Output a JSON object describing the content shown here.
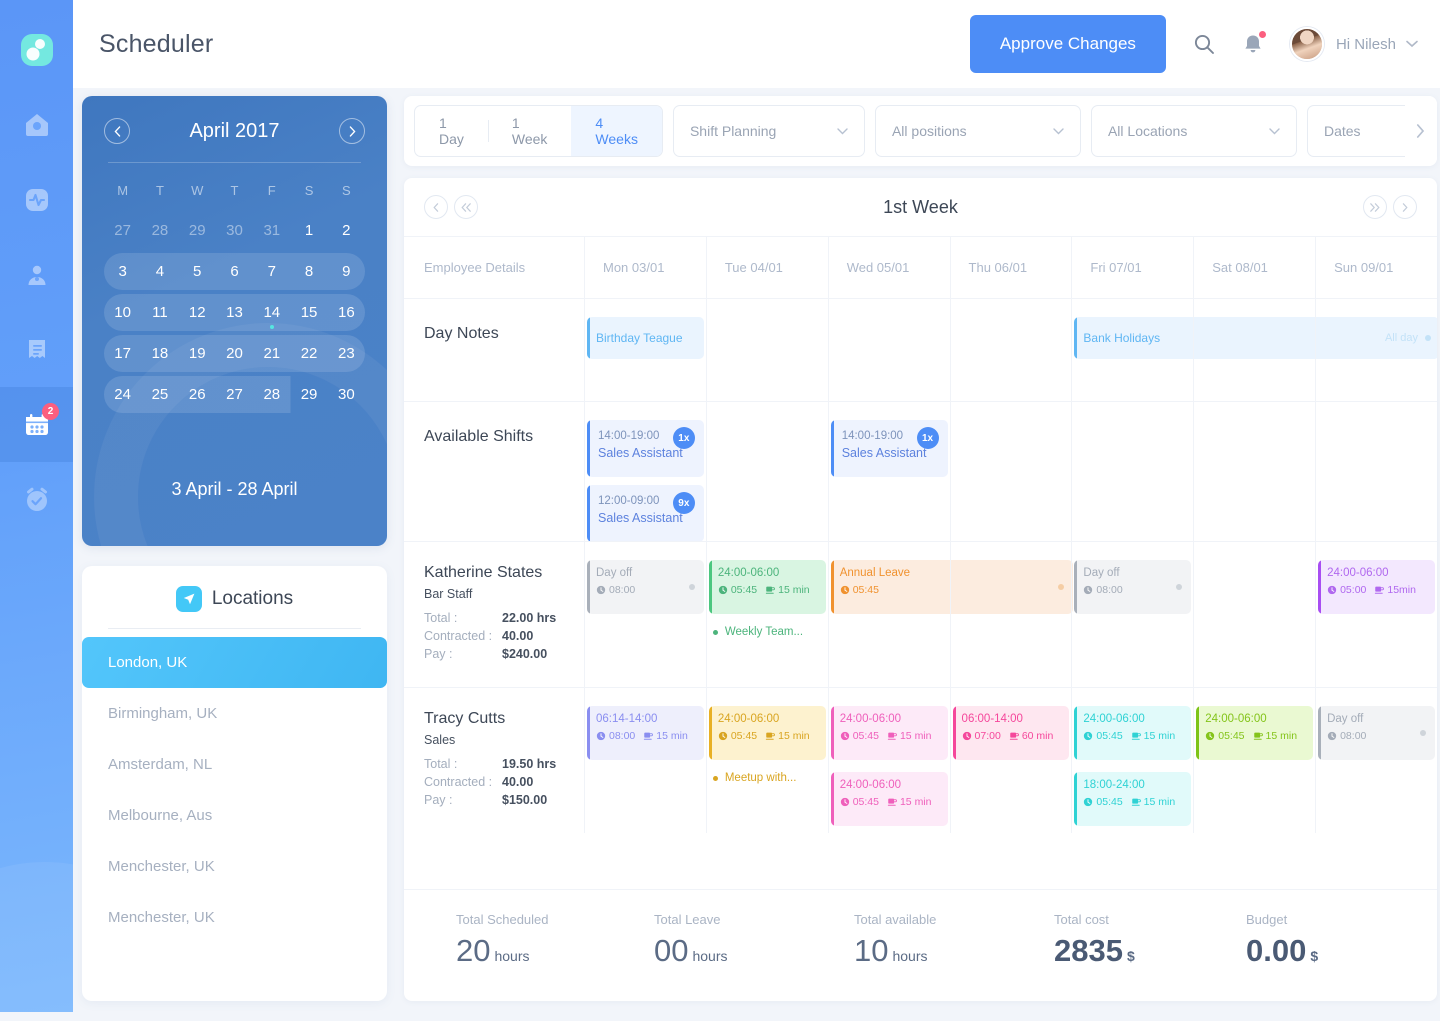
{
  "rail": {
    "items": [
      {
        "name": "logo",
        "icon": "logo-icon",
        "active": false
      },
      {
        "name": "home",
        "icon": "home-icon",
        "active": false
      },
      {
        "name": "activity",
        "icon": "activity-icon",
        "active": false
      },
      {
        "name": "people",
        "icon": "user-icon",
        "active": false
      },
      {
        "name": "documents",
        "icon": "document-icon",
        "active": false
      },
      {
        "name": "scheduler",
        "icon": "calendar-icon",
        "active": true,
        "badge": "2"
      },
      {
        "name": "timeclock",
        "icon": "clock-icon",
        "active": false
      }
    ]
  },
  "header": {
    "title": "Scheduler",
    "approve_label": "Approve Changes",
    "search_icon": "search-icon",
    "bell_icon": "bell-icon",
    "user_greeting": "Hi Nilesh"
  },
  "calendar": {
    "month_label": "April 2017",
    "prev_icon": "chevron-left-icon",
    "next_icon": "chevron-right-icon",
    "dow": [
      "M",
      "T",
      "W",
      "T",
      "F",
      "S",
      "S"
    ],
    "weeks": [
      {
        "selected": "none",
        "days": [
          {
            "n": "27",
            "muted": true
          },
          {
            "n": "28",
            "muted": true
          },
          {
            "n": "29",
            "muted": true
          },
          {
            "n": "30",
            "muted": true
          },
          {
            "n": "31",
            "muted": true
          },
          {
            "n": "1",
            "muted": false
          },
          {
            "n": "2",
            "muted": false
          }
        ]
      },
      {
        "selected": "full",
        "days": [
          {
            "n": "3"
          },
          {
            "n": "4"
          },
          {
            "n": "5"
          },
          {
            "n": "6"
          },
          {
            "n": "7"
          },
          {
            "n": "8"
          },
          {
            "n": "9"
          }
        ]
      },
      {
        "selected": "full",
        "days": [
          {
            "n": "10"
          },
          {
            "n": "11"
          },
          {
            "n": "12"
          },
          {
            "n": "13"
          },
          {
            "n": "14",
            "dot": true
          },
          {
            "n": "15"
          },
          {
            "n": "16"
          }
        ]
      },
      {
        "selected": "full",
        "days": [
          {
            "n": "17"
          },
          {
            "n": "18"
          },
          {
            "n": "19"
          },
          {
            "n": "20"
          },
          {
            "n": "21"
          },
          {
            "n": "22"
          },
          {
            "n": "23"
          }
        ]
      },
      {
        "selected": "partial",
        "days": [
          {
            "n": "24"
          },
          {
            "n": "25"
          },
          {
            "n": "26"
          },
          {
            "n": "27"
          },
          {
            "n": "28"
          },
          {
            "n": "29"
          },
          {
            "n": "30"
          }
        ]
      }
    ],
    "range_label": "3 April - 28 April"
  },
  "locations": {
    "title": "Locations",
    "icon": "location-pin-icon",
    "items": [
      {
        "label": "London, UK",
        "active": true
      },
      {
        "label": "Birmingham, UK",
        "active": false
      },
      {
        "label": "Amsterdam, NL",
        "active": false
      },
      {
        "label": "Melbourne, Aus",
        "active": false
      },
      {
        "label": "Menchester, UK",
        "active": false
      },
      {
        "label": "Menchester, UK",
        "active": false
      }
    ]
  },
  "filters": {
    "segments": [
      {
        "label": "1 Day",
        "active": false
      },
      {
        "label": "1 Week",
        "active": false
      },
      {
        "label": "4 Weeks",
        "active": true
      }
    ],
    "selects": [
      {
        "label": "Shift Planning"
      },
      {
        "label": "All positions"
      },
      {
        "label": "All Locations"
      },
      {
        "label": "Dates"
      }
    ],
    "next_icon": "chevron-right-icon"
  },
  "schedule": {
    "week_title": "1st Week",
    "nav": {
      "prev_icon": "chevron-left-icon",
      "prev_fast_icon": "chevrons-left-icon",
      "next_fast_icon": "chevrons-right-icon",
      "next_icon": "chevron-right-icon"
    },
    "columns": [
      "Employee Details",
      "Mon 03/01",
      "Tue 04/01",
      "Wed 05/01",
      "Thu 06/01",
      "Fri 07/01",
      "Sat 08/01",
      "Sun 09/01"
    ],
    "day_notes": {
      "label": "Day Notes",
      "entries": [
        {
          "day": 0,
          "text": "Birthday Teague",
          "span": 1,
          "allday": ""
        },
        {
          "day": 4,
          "text": "Bank Holidays",
          "span": 3,
          "allday": "All day"
        }
      ]
    },
    "available_shifts": {
      "label": "Available Shifts",
      "entries": [
        {
          "day": 0,
          "time": "14:00-19:00",
          "role": "Sales Assistant",
          "count": "1x"
        },
        {
          "day": 0,
          "time": "12:00-09:00",
          "role": "Sales Assistant",
          "count": "9x"
        },
        {
          "day": 2,
          "time": "14:00-19:00",
          "role": "Sales Assistant",
          "count": "1x"
        }
      ]
    },
    "employees": [
      {
        "name": "Katherine States",
        "role": "Bar Staff",
        "stats": [
          {
            "key": "Total :",
            "value": "22.00 hrs"
          },
          {
            "key": "Contracted :",
            "value": "40.00"
          },
          {
            "key": "Pay :",
            "value": "$240.00"
          }
        ],
        "cells": [
          {
            "day": 0,
            "kind": "dayoff",
            "title": "Day off",
            "duration": "08:00",
            "break": "",
            "color": "gray"
          },
          {
            "day": 1,
            "kind": "shift",
            "title": "24:00-06:00",
            "duration": "05:45",
            "break": "15 min",
            "color": "green",
            "event": "Weekly Team..."
          },
          {
            "day": 2,
            "kind": "leave",
            "title": "Annual Leave",
            "duration": "05:45",
            "break": "",
            "color": "orange",
            "span": 2
          },
          {
            "day": 4,
            "kind": "dayoff",
            "title": "Day off",
            "duration": "08:00",
            "break": "",
            "color": "gray"
          },
          {
            "day": 6,
            "kind": "shift",
            "title": "24:00-06:00",
            "duration": "05:00",
            "break": "15min",
            "color": "purple"
          }
        ]
      },
      {
        "name": "Tracy Cutts",
        "role": "Sales",
        "stats": [
          {
            "key": "Total :",
            "value": "19.50 hrs"
          },
          {
            "key": "Contracted :",
            "value": "40.00"
          },
          {
            "key": "Pay :",
            "value": "$150.00"
          }
        ],
        "cells": [
          {
            "day": 0,
            "kind": "shift",
            "title": "06:14-14:00",
            "duration": "08:00",
            "break": "15 min",
            "color": "indigo"
          },
          {
            "day": 1,
            "kind": "shift",
            "title": "24:00-06:00",
            "duration": "05:45",
            "break": "15 min",
            "color": "yellow",
            "event": "Meetup with..."
          },
          {
            "day": 2,
            "kind": "shift",
            "title": "24:00-06:00",
            "duration": "05:45",
            "break": "15 min",
            "color": "pink"
          },
          {
            "day": 2,
            "kind": "shift",
            "title": "24:00-06:00",
            "duration": "05:45",
            "break": "15 min",
            "color": "pink",
            "second": true
          },
          {
            "day": 3,
            "kind": "shift",
            "title": "06:00-14:00",
            "duration": "07:00",
            "break": "60 min",
            "color": "magenta"
          },
          {
            "day": 4,
            "kind": "shift",
            "title": "24:00-06:00",
            "duration": "05:45",
            "break": "15 min",
            "color": "cyan"
          },
          {
            "day": 4,
            "kind": "shift",
            "title": "18:00-24:00",
            "duration": "05:45",
            "break": "15 min",
            "color": "cyan",
            "second": true
          },
          {
            "day": 5,
            "kind": "shift",
            "title": "24:00-06:00",
            "duration": "05:45",
            "break": "15 min",
            "color": "lime"
          },
          {
            "day": 6,
            "kind": "dayoff",
            "title": "Day off",
            "duration": "08:00",
            "break": "",
            "color": "gray"
          }
        ]
      }
    ],
    "totals": [
      {
        "label": "Total Scheduled",
        "value": "20",
        "unit": "hours",
        "bold": false
      },
      {
        "label": "Total Leave",
        "value": "00",
        "unit": "hours",
        "bold": false
      },
      {
        "label": "Total available",
        "value": "10",
        "unit": "hours",
        "bold": false
      },
      {
        "label": "Total cost",
        "value": "2835",
        "unit": "$",
        "bold": true
      },
      {
        "label": "Budget",
        "value": "0.00",
        "unit": "$",
        "bold": true
      }
    ]
  },
  "colors": {
    "accent": "#4d8df6",
    "green": "#52c285",
    "orange": "#f0922f",
    "purple": "#a855f7",
    "indigo": "#8a8ef0",
    "yellow": "#e8b024",
    "pink": "#ef5fbb",
    "magenta": "#f5479b",
    "cyan": "#2fd2d4",
    "lime": "#84cc16",
    "gray": "#9aa3ae"
  }
}
